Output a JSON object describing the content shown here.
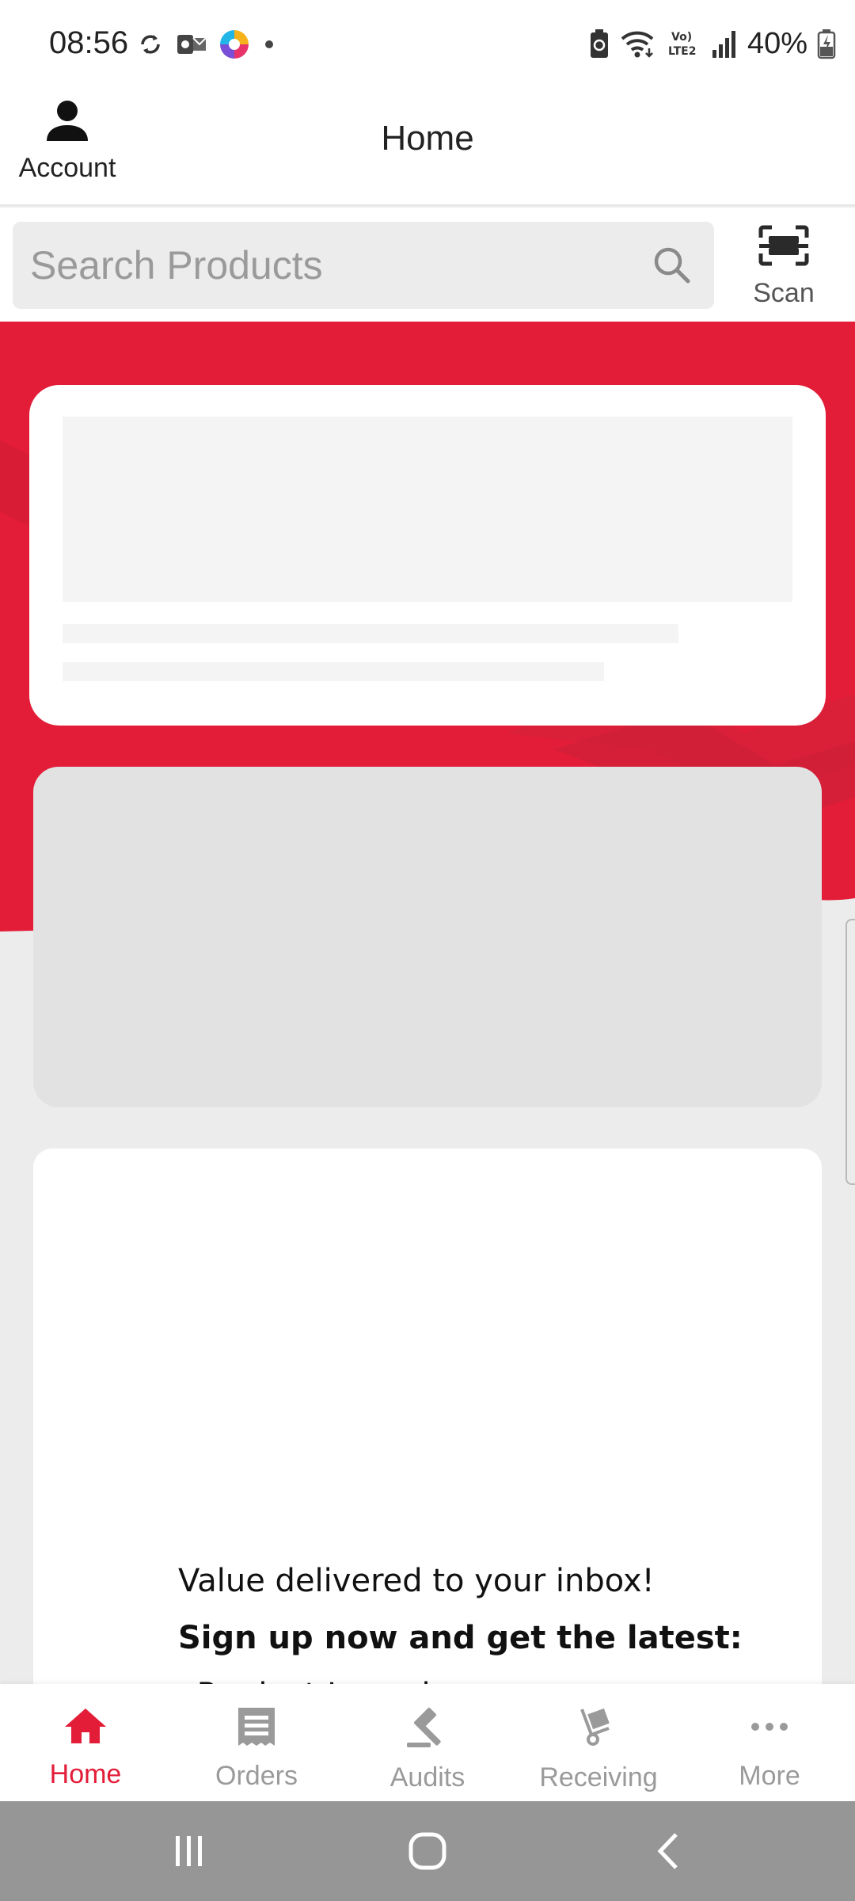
{
  "status_bar": {
    "time": "08:56",
    "battery_percent": "40%",
    "signal_label": "Vo) LTE2",
    "left_icons": [
      "sync-icon",
      "outlook-icon",
      "browser-icon",
      "notification-dot-icon"
    ],
    "right_icons": [
      "battery-saver-icon",
      "wifi-icon",
      "volte-icon",
      "signal-icon",
      "battery-icon"
    ]
  },
  "header": {
    "account_label": "Account",
    "title": "Home"
  },
  "search": {
    "placeholder": "Search Products",
    "value": "",
    "scan_label": "Scan"
  },
  "promo": {
    "line1": "Value delivered to your inbox!",
    "line2": "Sign up now and get the latest:",
    "line3": "•Product Launches"
  },
  "bottom_nav": {
    "items": [
      {
        "label": "Home",
        "icon": "home-icon",
        "active": true
      },
      {
        "label": "Orders",
        "icon": "receipt-icon",
        "active": false
      },
      {
        "label": "Audits",
        "icon": "gavel-icon",
        "active": false
      },
      {
        "label": "Receiving",
        "icon": "hand-truck-icon",
        "active": false
      },
      {
        "label": "More",
        "icon": "more-dots-icon",
        "active": false
      }
    ]
  },
  "colors": {
    "brand_red": "#e31d38",
    "inactive_gray": "#9a9a9a",
    "background": "#ececec"
  }
}
